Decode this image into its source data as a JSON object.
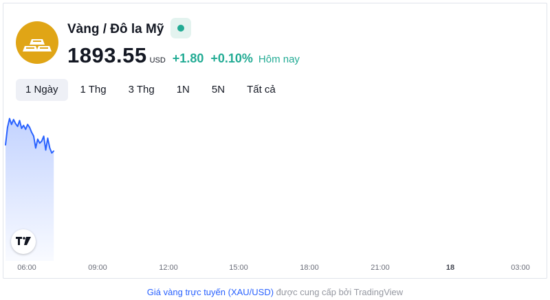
{
  "symbol": {
    "name": "Vàng / Đô la Mỹ",
    "logo_icon": "gold-bars-icon",
    "status": "market-open",
    "status_color": "#22ab94"
  },
  "quote": {
    "price": "1893.55",
    "currency": "USD",
    "change": "+1.80",
    "change_percent": "+0.10%",
    "period": "Hôm nay",
    "change_color": "#22ab94"
  },
  "range_tabs": [
    {
      "label": "1 Ngày",
      "active": true
    },
    {
      "label": "1 Thg",
      "active": false
    },
    {
      "label": "3 Thg",
      "active": false
    },
    {
      "label": "1N",
      "active": false
    },
    {
      "label": "5N",
      "active": false
    },
    {
      "label": "Tất cả",
      "active": false
    }
  ],
  "chart_data": {
    "type": "area",
    "line_color": "#2962ff",
    "x": [
      "05:30",
      "05:35",
      "05:40",
      "05:45",
      "05:50",
      "05:55",
      "06:00",
      "06:05",
      "06:10",
      "06:15",
      "06:20",
      "06:25",
      "06:30",
      "06:35",
      "06:40",
      "06:45",
      "06:50",
      "06:55",
      "07:00",
      "07:05",
      "07:10",
      "07:15",
      "07:20",
      "07:25",
      "07:30"
    ],
    "y": [
      1891.5,
      1893.3,
      1894.2,
      1893.6,
      1894.1,
      1893.7,
      1893.4,
      1894.0,
      1893.2,
      1893.5,
      1893.1,
      1893.6,
      1893.3,
      1892.8,
      1892.4,
      1891.2,
      1892.1,
      1891.7,
      1891.9,
      1892.4,
      1891.0,
      1892.2,
      1891.2,
      1890.7,
      1890.9
    ],
    "x_ticks": [
      "06:00",
      "09:00",
      "12:00",
      "15:00",
      "18:00",
      "21:00",
      "18",
      "03:00"
    ],
    "x_range": [
      "05:30",
      "04:00"
    ],
    "grid": false
  },
  "footer": {
    "link_text": "Giá vàng trực tuyến (XAU/USD)",
    "text": " được cung cấp bởi TradingView"
  },
  "branding": {
    "tv_icon": "tradingview-logo-icon"
  }
}
